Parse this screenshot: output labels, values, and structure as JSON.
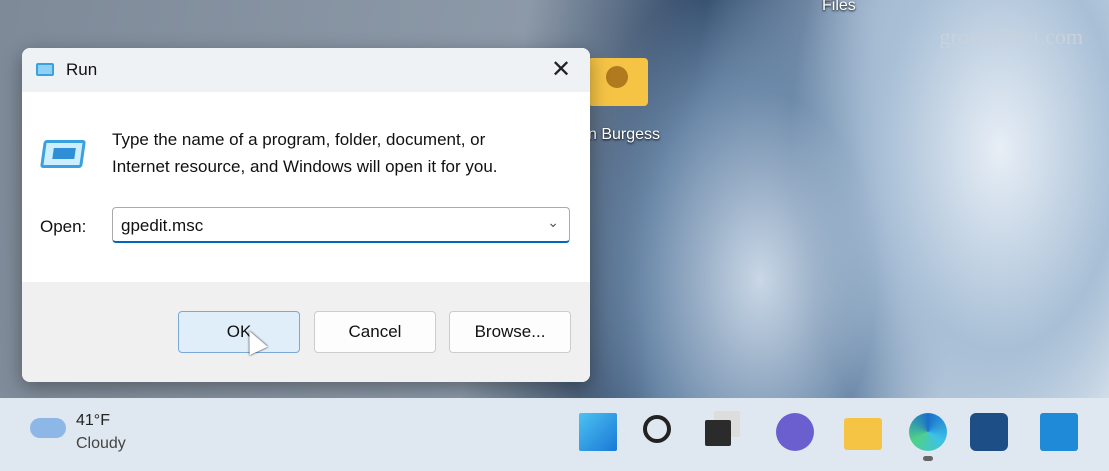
{
  "desktop": {
    "labels": [
      "Files",
      "n Burgess"
    ],
    "watermark": "groovyPost.com"
  },
  "dialog": {
    "title": "Run",
    "description_line1": "Type the name of a program, folder, document, or",
    "description_line2": "Internet resource, and Windows will open it for you.",
    "open_label": "Open:",
    "open_value": "gpedit.msc",
    "ok_label": "OK",
    "cancel_label": "Cancel",
    "browse_label": "Browse...",
    "close_glyph": "✕"
  },
  "taskbar": {
    "temperature": "41°F",
    "condition": "Cloudy",
    "apps": [
      "start",
      "search",
      "task-view",
      "teams-chat",
      "file-explorer",
      "edge",
      "microsoft-store",
      "remote-desktop"
    ]
  }
}
